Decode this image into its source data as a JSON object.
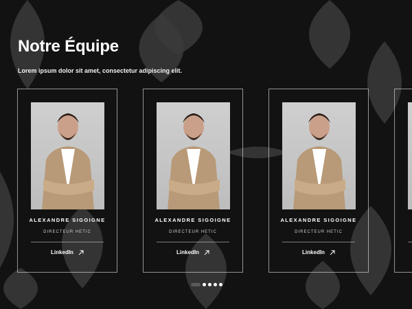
{
  "header": {
    "title": "Notre Équipe",
    "subtitle": "Lorem ipsum dolor sit amet, consectetur adipiscing elit."
  },
  "team": [
    {
      "name": "ALEXANDRE SIGOIGNE",
      "role": "DIRECTEUR HETIC",
      "link_label": "LinkedIn",
      "link_icon": "arrow-up-right-icon"
    },
    {
      "name": "ALEXANDRE SIGOIGNE",
      "role": "DIRECTEUR HETIC",
      "link_label": "LinkedIn",
      "link_icon": "arrow-up-right-icon"
    },
    {
      "name": "ALEXANDRE SIGOIGNE",
      "role": "DIRECTEUR HETIC",
      "link_label": "LinkedIn",
      "link_icon": "arrow-up-right-icon"
    }
  ],
  "pagination": {
    "total": 5,
    "active_index": 0
  },
  "colors": {
    "background": "#121212",
    "text": "#ffffff",
    "muted": "#cfcfcf",
    "pattern": "#3a3a3a"
  }
}
